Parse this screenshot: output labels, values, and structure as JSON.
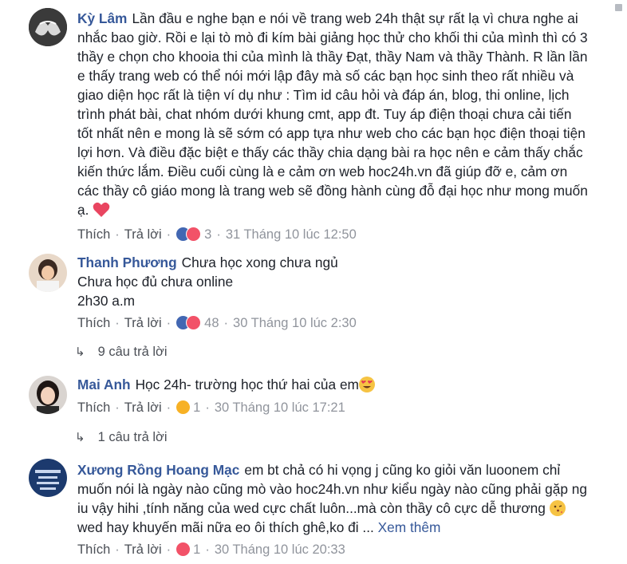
{
  "comments": [
    {
      "author": "Kỳ Lâm",
      "text": "Lần đầu e nghe bạn e nói về trang web 24h thật sự rất lạ vì chưa nghe ai nhắc bao giờ. Rồi e lại tò mò đi kím bài giảng học thử cho khối thi của mình thì có 3 thầy e chọn cho khooia thi của mình là thầy Đạt, thầy Nam và thầy Thành. R lần lần e thấy trang web có thể nói mới lập đây mà số các bạn học sinh theo rất nhiều và giao diện học rất là tiện ví dụ như : Tìm id câu hỏi và đáp án, blog, thi online, lịch trình phát bài, chat nhóm dưới khung cmt, app đt. Tuy áp điện thoại chưa cải tiến tốt nhất nên e mong là sẽ sớm có app tựa như web cho các bạn học điện thoại tiện lợi hơn. Và điều đặc biệt e thấy các thầy chia dạng bài ra học nên e cảm thấy chắc kiến thức lắm. Điều cuối cùng là e cảm ơn web hoc24h.vn đã giúp đỡ e, cảm ơn các thầy cô giáo mong là trang web sẽ đồng hành cùng đỗ đại học như mong muốn ạ.",
      "emoji": "heart-emoji",
      "like": "Thích",
      "reply": "Trả lời",
      "reaction_icons": [
        "like-reaction-icon",
        "heart-reaction-icon"
      ],
      "reaction_count": "3",
      "timestamp": "31 Tháng 10 lúc 12:50"
    },
    {
      "author": "Thanh Phương",
      "line1": "Chưa học xong chưa ngủ",
      "line2": "Chưa học đủ chưa online",
      "line3": "2h30 a.m",
      "like": "Thích",
      "reply": "Trả lời",
      "reaction_icons": [
        "like-reaction-icon",
        "heart-reaction-icon"
      ],
      "reaction_count": "48",
      "timestamp": "30 Tháng 10 lúc 2:30",
      "replies_label": "9 câu trả lời"
    },
    {
      "author": "Mai Anh",
      "text": "Học 24h- trường học thứ hai của em",
      "emoji": "heart-eyes-emoji",
      "like": "Thích",
      "reply": "Trả lời",
      "reaction_icons": [
        "wow-reaction-icon"
      ],
      "reaction_count": "1",
      "timestamp": "30 Tháng 10 lúc 17:21",
      "replies_label": "1 câu trả lời"
    },
    {
      "author": "Xương Rồng Hoang Mạc",
      "text_a": "em bt chả có hi vọng j cũng ko giỏi văn luoonem chỉ muốn nói là ngày nào cũng mò vào hoc24h.vn như kiểu ngày nào cũng phải gặp ng iu vậy hihi ,tính năng của wed cực chất luôn...mà còn thầy cô cực dễ thương",
      "emoji": "kissing-emoji",
      "text_b": "wed hay khuyến mãi nữa eo ôi thích ghê,ko đi ...",
      "see_more": "Xem thêm",
      "like": "Thích",
      "reply": "Trả lời",
      "reaction_icons": [
        "heart-reaction-icon"
      ],
      "reaction_count": "1",
      "timestamp": "30 Tháng 10 lúc 20:33"
    }
  ],
  "colors": {
    "author": "#365899",
    "meta": "#90949c",
    "link": "#4b4f56",
    "like_reaction": "#4267b2",
    "heart_reaction": "#f25268",
    "wow_reaction": "#f7b125"
  }
}
